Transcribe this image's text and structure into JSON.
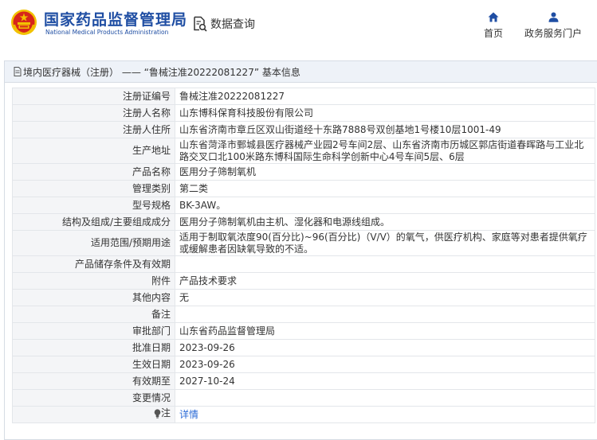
{
  "header": {
    "logo_cn": "国家药品监督管理局",
    "logo_en": "National Medical Products Administration",
    "search_label": "数据查询",
    "nav": [
      {
        "label": "首页",
        "icon": "home-icon"
      },
      {
        "label": "政务服务门户",
        "icon": "person-icon"
      }
    ],
    "colors": {
      "brand": "#1f4ea3",
      "emblem_red": "#d7261b",
      "emblem_gold": "#f2c200"
    }
  },
  "panel": {
    "title": "境内医疗器械（注册） —— “鲁械注准20222081227” 基本信息",
    "icon": "document-icon"
  },
  "rows": [
    {
      "label": "注册证编号",
      "value": "鲁械注准20222081227"
    },
    {
      "label": "注册人名称",
      "value": "山东博科保育科技股份有限公司"
    },
    {
      "label": "注册人住所",
      "value": "山东省济南市章丘区双山街道经十东路7888号双创基地1号楼10层1001-49"
    },
    {
      "label": "生产地址",
      "value": "山东省菏泽市鄄城县医疗器械产业园2号车间2层、山东省济南市历城区郭店街道春晖路与工业北路交叉口北100米路东博科国际生命科学创新中心4号车间5层、6层"
    },
    {
      "label": "产品名称",
      "value": "医用分子筛制氧机"
    },
    {
      "label": "管理类别",
      "value": "第二类"
    },
    {
      "label": "型号规格",
      "value": "BK-3AW。"
    },
    {
      "label": "结构及组成/主要组成成分",
      "value": "医用分子筛制氧机由主机、湿化器和电源线组成。"
    },
    {
      "label": "适用范围/预期用途",
      "value": "适用于制取氧浓度90(百分比)~96(百分比)（V/V）的氧气，供医疗机构、家庭等对患者提供氧疗或缓解患者因缺氧导致的不适。"
    },
    {
      "label": "产品储存条件及有效期",
      "value": ""
    },
    {
      "label": "附件",
      "value": "产品技术要求"
    },
    {
      "label": "其他内容",
      "value": "无"
    },
    {
      "label": "备注",
      "value": ""
    },
    {
      "label": "审批部门",
      "value": "山东省药品监督管理局"
    },
    {
      "label": "批准日期",
      "value": "2023-09-26"
    },
    {
      "label": "生效日期",
      "value": "2023-09-26"
    },
    {
      "label": "有效期至",
      "value": "2027-10-24"
    },
    {
      "label": "变更情况",
      "value": ""
    }
  ],
  "note": {
    "label": "注",
    "link": "详情",
    "icon": "bulb-icon"
  }
}
